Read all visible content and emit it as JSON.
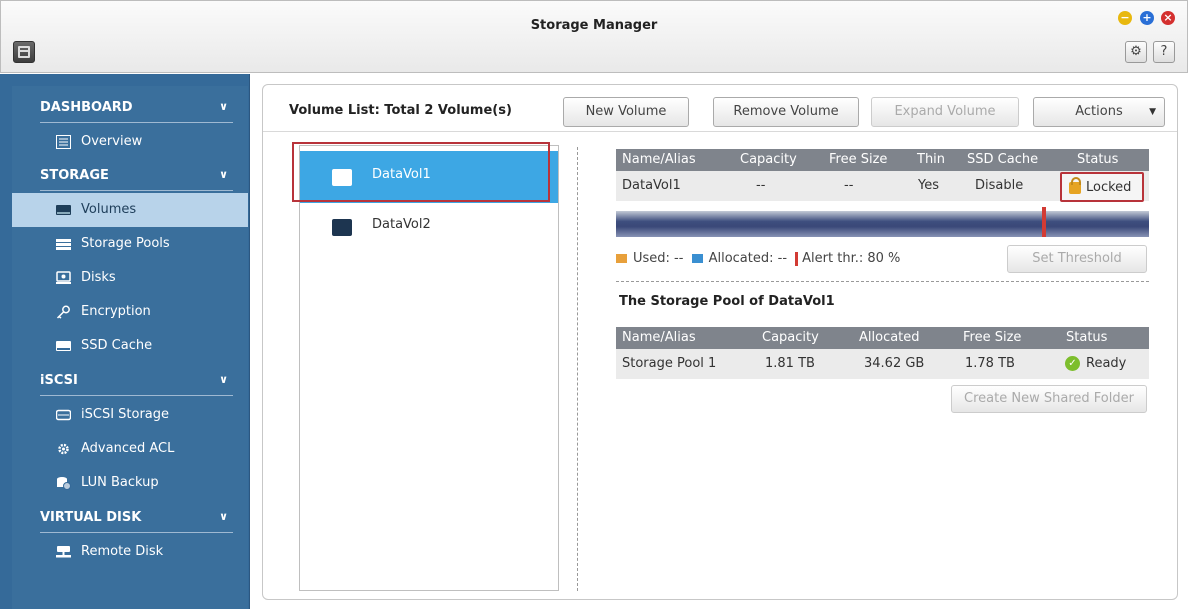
{
  "window": {
    "title": "Storage Manager"
  },
  "toolbar": {
    "gear_icon": "gear-icon",
    "help_label": "?"
  },
  "sidebar": {
    "sections": [
      {
        "label": "DASHBOARD",
        "items": [
          {
            "label": "Overview",
            "icon": "overview-icon"
          }
        ]
      },
      {
        "label": "STORAGE",
        "items": [
          {
            "label": "Volumes",
            "icon": "volume-icon",
            "active": true
          },
          {
            "label": "Storage Pools",
            "icon": "storage-pool-icon"
          },
          {
            "label": "Disks",
            "icon": "disk-icon"
          },
          {
            "label": "Encryption",
            "icon": "key-icon"
          },
          {
            "label": "SSD Cache",
            "icon": "ssd-icon"
          }
        ]
      },
      {
        "label": "iSCSI",
        "items": [
          {
            "label": "iSCSI Storage",
            "icon": "iscsi-storage-icon"
          },
          {
            "label": "Advanced ACL",
            "icon": "acl-gear-icon"
          },
          {
            "label": "LUN Backup",
            "icon": "lun-backup-icon"
          }
        ]
      },
      {
        "label": "VIRTUAL DISK",
        "items": [
          {
            "label": "Remote Disk",
            "icon": "remote-disk-icon"
          }
        ]
      }
    ]
  },
  "main": {
    "volume_list_title": "Volume List: Total 2 Volume(s)",
    "buttons": {
      "new_volume": "New Volume",
      "remove_volume": "Remove Volume",
      "expand_volume": "Expand Volume",
      "actions": "Actions"
    },
    "volumes": [
      "DataVol1",
      "DataVol2"
    ],
    "selected_volume": "DataVol1",
    "volume_table": {
      "headers": [
        "Name/Alias",
        "Capacity",
        "Free Size",
        "Thin",
        "SSD Cache",
        "Status"
      ],
      "row": [
        "DataVol1",
        "--",
        "--",
        "Yes",
        "Disable",
        "Locked"
      ]
    },
    "legend": {
      "used": "Used: --",
      "allocated": "Allocated: --",
      "alert": "Alert thr.: 80 %"
    },
    "alert_threshold_fraction": 0.8,
    "set_threshold": "Set Threshold",
    "pool_title": "The Storage Pool of DataVol1",
    "pool_table": {
      "headers": [
        "Name/Alias",
        "Capacity",
        "Allocated",
        "Free Size",
        "Status"
      ],
      "row": [
        "Storage Pool 1",
        "1.81 TB",
        "34.62 GB",
        "1.78 TB",
        "Ready"
      ]
    },
    "create_shared_folder": "Create New Shared Folder"
  },
  "colors": {
    "sidebar_bg": "#356a99",
    "sidebar_active": "#b8d3ea",
    "selected_volume": "#3da7e4",
    "highlight_frame": "#b8333a",
    "table_header": "#7f848c"
  }
}
